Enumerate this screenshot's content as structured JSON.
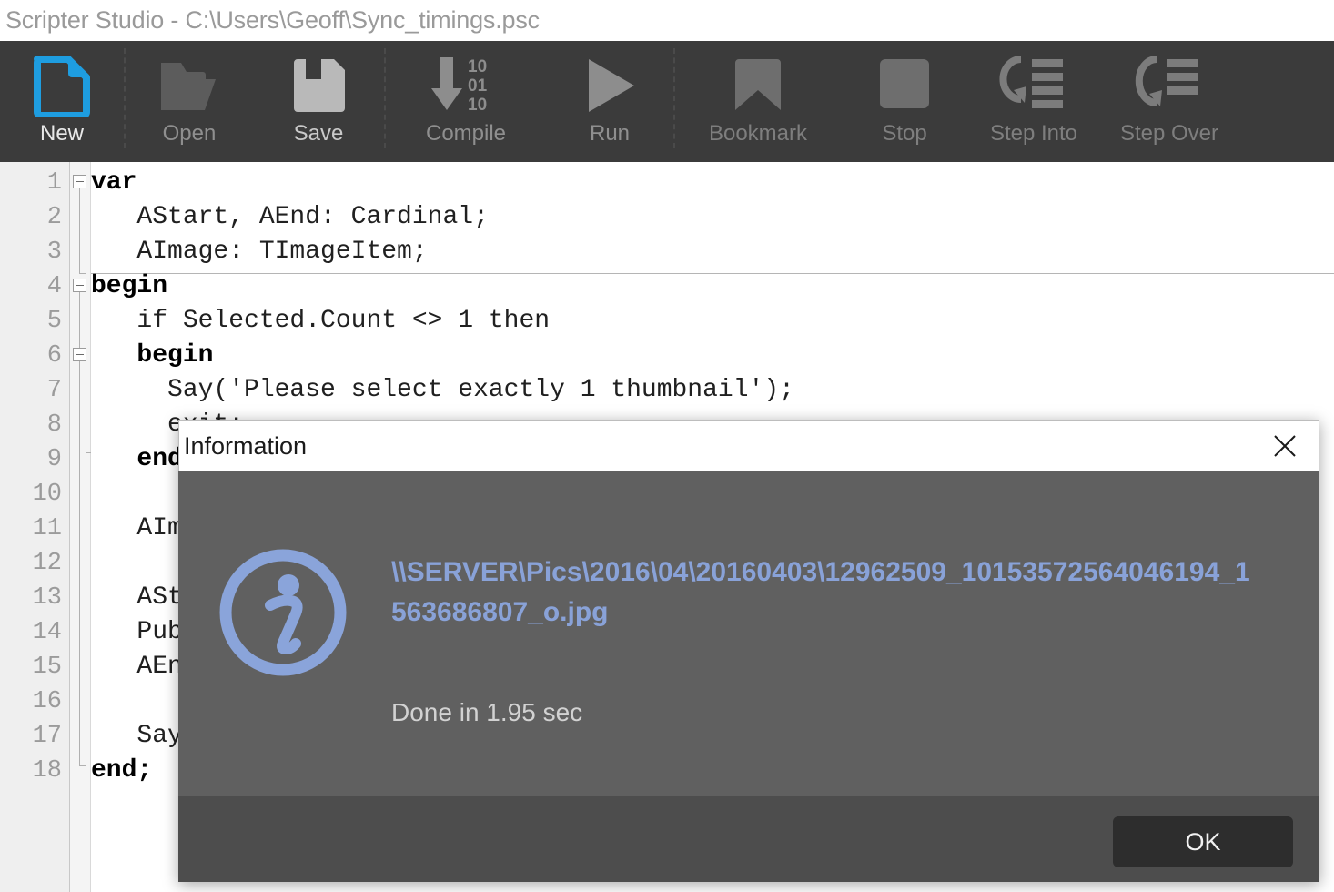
{
  "window": {
    "title": "Scripter Studio - C:\\Users\\Geoff\\Sync_timings.psc"
  },
  "toolbar": {
    "items": [
      {
        "label": "New",
        "icon": "new-document-icon",
        "state": "active"
      },
      {
        "label": "Open",
        "icon": "open-folder-icon",
        "state": "disabled"
      },
      {
        "label": "Save",
        "icon": "floppy-disk-icon",
        "state": "enabled"
      },
      {
        "label": "Compile",
        "icon": "compile-arrow-binary-icon",
        "state": "enabled"
      },
      {
        "label": "Run",
        "icon": "play-triangle-icon",
        "state": "enabled"
      },
      {
        "label": "Bookmark",
        "icon": "bookmark-icon",
        "state": "disabled"
      },
      {
        "label": "Stop",
        "icon": "stop-square-icon",
        "state": "disabled"
      },
      {
        "label": "Step Into",
        "icon": "step-into-icon",
        "state": "disabled"
      },
      {
        "label": "Step Over",
        "icon": "step-over-icon",
        "state": "disabled"
      }
    ]
  },
  "editor": {
    "line_numbers": [
      "1",
      "2",
      "3",
      "4",
      "5",
      "6",
      "7",
      "8",
      "9",
      "10",
      "11",
      "12",
      "13",
      "14",
      "15",
      "16",
      "17",
      "18"
    ],
    "lines": [
      {
        "n": "1",
        "text": "var",
        "bold": true
      },
      {
        "n": "2",
        "text": "   AStart, AEnd: Cardinal;",
        "bold": false
      },
      {
        "n": "3",
        "text": "   AImage: TImageItem;",
        "bold": false
      },
      {
        "n": "4",
        "text": "begin",
        "bold": true
      },
      {
        "n": "5",
        "text": "   if Selected.Count <> 1 then",
        "bold": false
      },
      {
        "n": "6",
        "text": "   begin",
        "bold": true
      },
      {
        "n": "7",
        "text": "     Say('Please select exactly 1 thumbnail');",
        "bold": false
      },
      {
        "n": "8",
        "text": "     exit;",
        "bold": false
      },
      {
        "n": "9",
        "text": "   end;",
        "bold": true
      },
      {
        "n": "10",
        "text": "",
        "bold": false
      },
      {
        "n": "11",
        "text": "   AIm",
        "bold": false
      },
      {
        "n": "12",
        "text": "",
        "bold": false
      },
      {
        "n": "13",
        "text": "   ASt",
        "bold": false
      },
      {
        "n": "14",
        "text": "   Pub",
        "bold": false
      },
      {
        "n": "15",
        "text": "   AEn",
        "bold": false
      },
      {
        "n": "16",
        "text": "",
        "bold": false
      },
      {
        "n": "17",
        "text": "   Say",
        "bold": false
      },
      {
        "n": "18",
        "text": "end;",
        "bold": true
      }
    ]
  },
  "dialog": {
    "title": "Information",
    "close_label": "✕",
    "icon": "info-circle-icon",
    "message": "\\\\SERVER\\Pics\\2016\\04\\20160403\\12962509_10153572564046194_1563686807_o.jpg",
    "submessage": "Done in 1.95 sec",
    "ok_label": "OK"
  },
  "colors": {
    "accent_blue": "#1e9de0",
    "toolbar_bg": "#3b3b3b",
    "dialog_body": "#606060",
    "dialog_footer": "#4d4d4d",
    "message_blue": "#89a2d8",
    "ok_button_bg": "#2d2d2d"
  }
}
